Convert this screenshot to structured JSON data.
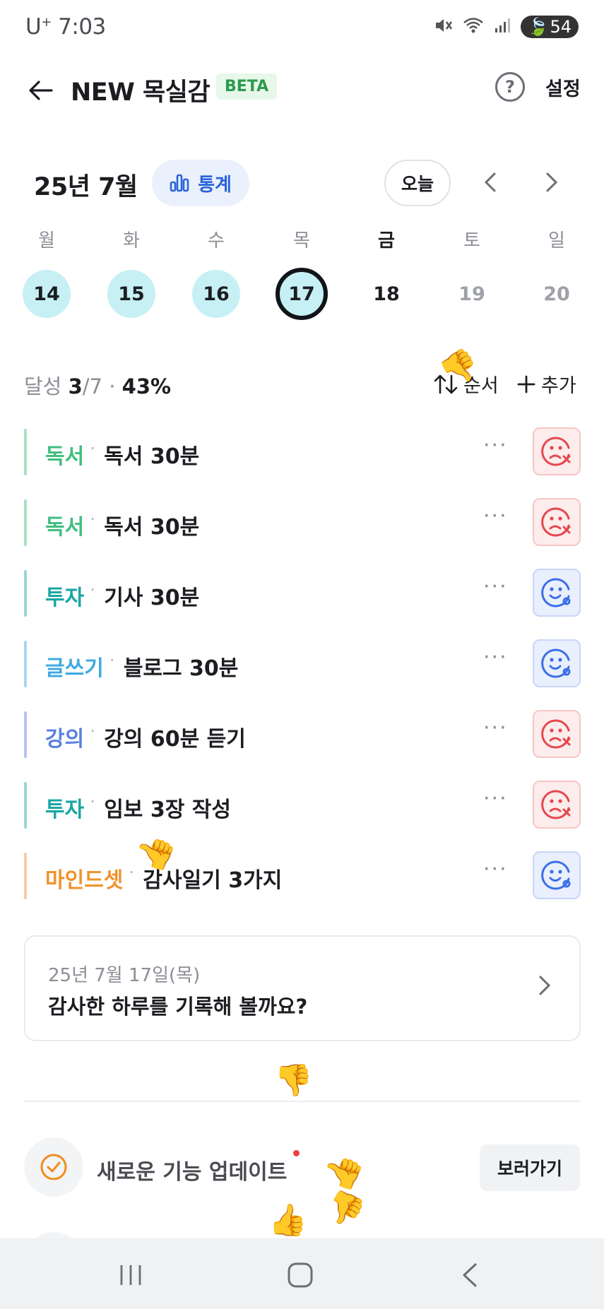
{
  "status_bar": {
    "carrier": "U",
    "carrier_sup": "+",
    "time": "7:03",
    "battery": "54"
  },
  "header": {
    "title": "NEW 목실감",
    "badge": "BETA",
    "help_label": "?",
    "settings_label": "설정"
  },
  "calendar": {
    "month_title": "25년 7월",
    "stats_label": "통계",
    "today_label": "오늘",
    "days": [
      {
        "name": "월",
        "num": "14"
      },
      {
        "name": "화",
        "num": "15"
      },
      {
        "name": "수",
        "num": "16"
      },
      {
        "name": "목",
        "num": "17"
      },
      {
        "name": "금",
        "num": "18"
      },
      {
        "name": "토",
        "num": "19"
      },
      {
        "name": "일",
        "num": "20"
      }
    ]
  },
  "achievement": {
    "label": "달성",
    "count": "3",
    "total": "/7",
    "sep": "·",
    "percent": "43%",
    "sort_label": "순서",
    "add_label": "추가"
  },
  "habits": [
    {
      "category": "독서",
      "name": "독서 30분",
      "status": "fail",
      "color": "#3fbf7f"
    },
    {
      "category": "독서",
      "name": "독서 30분",
      "status": "fail",
      "color": "#3fbf7f"
    },
    {
      "category": "투자",
      "name": "기사 30분",
      "status": "ok",
      "color": "#1ba6a6"
    },
    {
      "category": "글쓰기",
      "name": "블로그 30분",
      "status": "ok",
      "color": "#3fa9e0"
    },
    {
      "category": "강의",
      "name": "강의 60분 듣기",
      "status": "fail",
      "color": "#5b7fe0"
    },
    {
      "category": "투자",
      "name": "임보 3장 작성",
      "status": "fail",
      "color": "#1ba6a6"
    },
    {
      "category": "마인드셋",
      "name": "감사일기 3가지",
      "status": "ok",
      "color": "#f0922a"
    }
  ],
  "habit_more": "···",
  "gratitude": {
    "date": "25년 7월 17일(목)",
    "prompt": "감사한 하루를 기록해 볼까요?"
  },
  "feature": {
    "text": "새로운 기능 업데이트",
    "button": "보러가기"
  },
  "colors": {
    "accent_blue": "#2a63d8",
    "fail_red": "#e5484d",
    "ok_blue": "#3b6fe6",
    "done_day": "#c6f0f4",
    "feature_orange": "#f08c1a"
  }
}
